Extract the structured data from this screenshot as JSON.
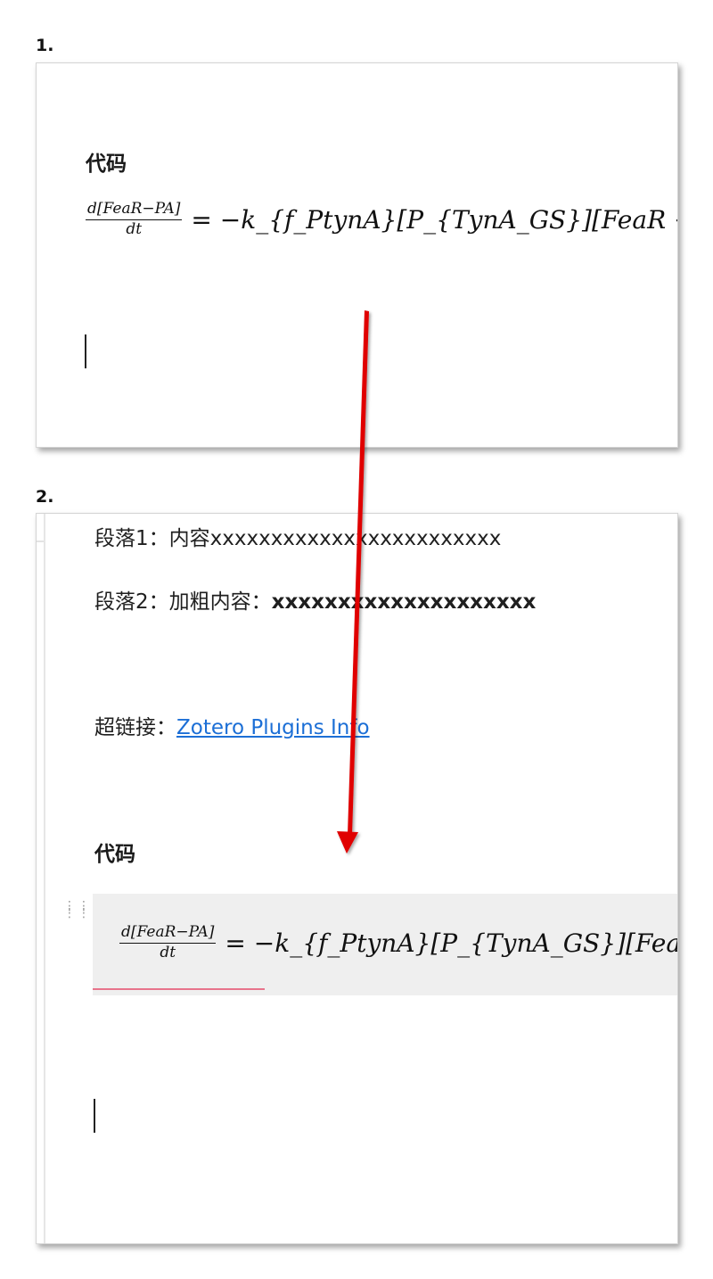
{
  "steps": [
    {
      "label": "1."
    },
    {
      "label": "2."
    }
  ],
  "panel1": {
    "heading": "代码",
    "equation": {
      "frac_num": "d[FeaR−PA]",
      "frac_den": "dt",
      "rhs": "= −k_{f_PtynA}[P_{TynA_GS}][FeaR − PA] +"
    }
  },
  "panel2": {
    "para1_label": "段落1：",
    "para1_text": "内容xxxxxxxxxxxxxxxxxxxxxxxx",
    "para2_label": "段落2：",
    "para2_mid": "加粗内容：",
    "para2_bold": "xxxxxxxxxxxxxxxxxxxx",
    "link_label": "超链接：",
    "link_text": "Zotero Plugins Info",
    "heading": "代码",
    "equation": {
      "frac_num": "d[FeaR−PA]",
      "frac_den": "dt",
      "rhs": "= −k_{f_PtynA}[P_{TynA_GS}][FeaR − PA]"
    }
  },
  "colors": {
    "arrow": "#e00000",
    "link": "#1c6fd6",
    "code_bg": "#efefef",
    "squiggle": "#e8748c"
  },
  "icons": {
    "drag_handle": "drag-handle-icon",
    "arrow": "red-arrow-annotation"
  }
}
